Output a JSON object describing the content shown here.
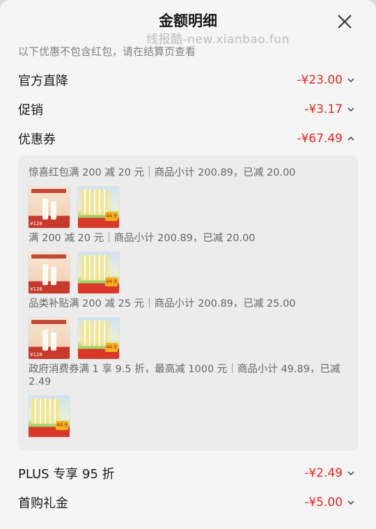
{
  "header": {
    "title": "金额明细",
    "watermark": "线报酷-new.xianbao.fun"
  },
  "note": "以下优惠不包含红包，请在结算页查看",
  "rows_top": [
    {
      "label": "官方直降",
      "amount": "-¥23.00",
      "expanded": false
    },
    {
      "label": "促销",
      "amount": "-¥3.17",
      "expanded": false
    },
    {
      "label": "优惠券",
      "amount": "-¥67.49",
      "expanded": true
    }
  ],
  "coupons": [
    {
      "text": "惊喜红包满 200 减 20 元｜商品小计 200.89，已减 20.00",
      "thumbs": [
        "sunscreen-product-icon",
        "tissue-pack-product-icon"
      ]
    },
    {
      "text": "满 200 减 20 元｜商品小计 200.89，已减 20.00",
      "thumbs": [
        "sunscreen-product-icon",
        "tissue-pack-product-icon"
      ]
    },
    {
      "text": "品类补贴满 200 减 25 元｜商品小计 200.89，已减 25.00",
      "thumbs": [
        "sunscreen-product-icon",
        "tissue-pack-product-icon"
      ]
    },
    {
      "text_line1": "政府消费券满 1 享 9.5 折，最高减 1000 元｜商品小计 49.89，已减",
      "text_line2": "2.49",
      "thumbs": [
        "tissue-pack-product-icon"
      ]
    }
  ],
  "rows_bottom": [
    {
      "label": "PLUS 专享 95 折",
      "amount": "-¥2.49",
      "expanded": false
    },
    {
      "label": "首购礼金",
      "amount": "-¥5.00",
      "expanded": false
    }
  ],
  "thumb_text": {
    "price_a": "¥128",
    "badge_b": "44.9"
  },
  "colors": {
    "amount_red": "#e8251e",
    "panel_bg": "#ececec",
    "sheet_bg": "#f5f5f5"
  }
}
